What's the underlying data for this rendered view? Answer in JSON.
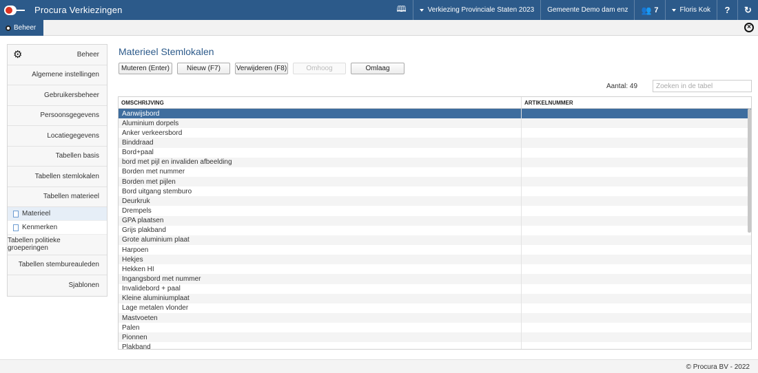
{
  "app": {
    "title": "Procura Verkiezingen"
  },
  "topbar": {
    "election_label": "Verkiezing Provinciale Staten 2023",
    "municipality_label": "Gemeente Demo dam enz",
    "users_count": "7",
    "user_name": "Floris Kok",
    "help_label": "?",
    "icons": [
      "book-icon",
      "caret-down-icon",
      "users-icon",
      "refresh-icon"
    ]
  },
  "tabs": [
    {
      "label": "Beheer",
      "active": true
    }
  ],
  "sidebar": {
    "header_label": "Beheer",
    "items": [
      {
        "label": "Algemene instellingen"
      },
      {
        "label": "Gebruikersbeheer"
      },
      {
        "label": "Persoonsgegevens"
      },
      {
        "label": "Locatiegegevens"
      },
      {
        "label": "Tabellen basis"
      },
      {
        "label": "Tabellen stemlokalen"
      },
      {
        "label": "Tabellen materieel"
      }
    ],
    "subitems": [
      {
        "label": "Materieel",
        "active": true
      },
      {
        "label": "Kenmerken",
        "active": false
      }
    ],
    "items_after": [
      {
        "label": "Tabellen politieke groeperingen"
      },
      {
        "label": "Tabellen stembureauleden"
      },
      {
        "label": "Sjablonen"
      }
    ]
  },
  "main": {
    "title": "Materieel Stemlokalen",
    "buttons": [
      {
        "label": "Muteren (Enter)",
        "disabled": false
      },
      {
        "label": "Nieuw (F7)",
        "disabled": false
      },
      {
        "label": "Verwijderen (F8)",
        "disabled": false
      },
      {
        "label": "Omhoog",
        "disabled": true
      },
      {
        "label": "Omlaag",
        "disabled": false
      }
    ],
    "count_label": "Aantal: 49",
    "search_placeholder": "Zoeken in de tabel",
    "table": {
      "columns": [
        "OMSCHRIJVING",
        "ARTIKELNUMMER"
      ],
      "rows": [
        {
          "omschrijving": "Aanwijsbord",
          "artikelnummer": "",
          "selected": true
        },
        {
          "omschrijving": "Aluminium dorpels",
          "artikelnummer": ""
        },
        {
          "omschrijving": "Anker verkeersbord",
          "artikelnummer": ""
        },
        {
          "omschrijving": "Binddraad",
          "artikelnummer": ""
        },
        {
          "omschrijving": "Bord+paal",
          "artikelnummer": ""
        },
        {
          "omschrijving": "bord met pijl en invaliden afbeelding",
          "artikelnummer": ""
        },
        {
          "omschrijving": "Borden met nummer",
          "artikelnummer": ""
        },
        {
          "omschrijving": "Borden met pijlen",
          "artikelnummer": ""
        },
        {
          "omschrijving": "Bord uitgang stemburo",
          "artikelnummer": ""
        },
        {
          "omschrijving": "Deurkruk",
          "artikelnummer": ""
        },
        {
          "omschrijving": "Drempels",
          "artikelnummer": ""
        },
        {
          "omschrijving": "GPA plaatsen",
          "artikelnummer": ""
        },
        {
          "omschrijving": "Grijs plakband",
          "artikelnummer": ""
        },
        {
          "omschrijving": "Grote aluminium plaat",
          "artikelnummer": ""
        },
        {
          "omschrijving": "Harpoen",
          "artikelnummer": ""
        },
        {
          "omschrijving": "Hekjes",
          "artikelnummer": ""
        },
        {
          "omschrijving": "Hekken HI",
          "artikelnummer": ""
        },
        {
          "omschrijving": "Ingangsbord met nummer",
          "artikelnummer": ""
        },
        {
          "omschrijving": "Invalidebord + paal",
          "artikelnummer": ""
        },
        {
          "omschrijving": "Kleine aluminiumplaat",
          "artikelnummer": ""
        },
        {
          "omschrijving": "Lage metalen vlonder",
          "artikelnummer": ""
        },
        {
          "omschrijving": "Mastvoeten",
          "artikelnummer": ""
        },
        {
          "omschrijving": "Palen",
          "artikelnummer": ""
        },
        {
          "omschrijving": "Pionnen",
          "artikelnummer": ""
        },
        {
          "omschrijving": "Plakband",
          "artikelnummer": ""
        }
      ]
    }
  },
  "footer": {
    "copyright": "© Procura BV - 2022"
  },
  "colors": {
    "brand": "#2c5a8a",
    "selected_row": "#3e6d9e"
  }
}
